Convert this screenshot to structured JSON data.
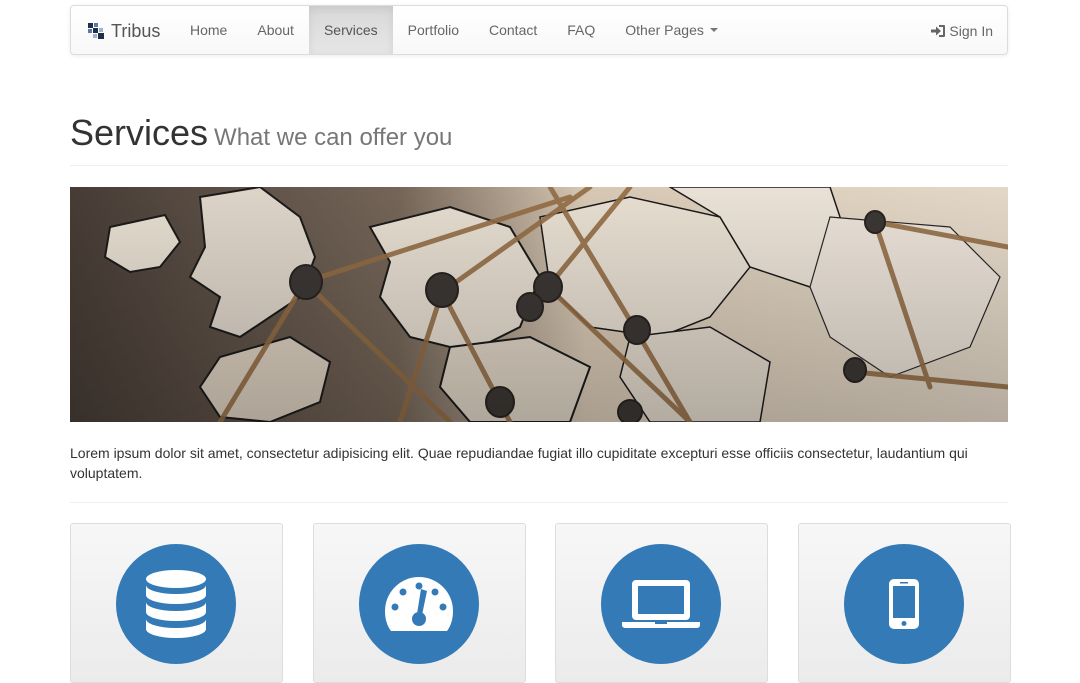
{
  "navbar": {
    "brand": "Tribus",
    "brand_icon": "tiles-logo-icon",
    "items": [
      {
        "label": "Home"
      },
      {
        "label": "About"
      },
      {
        "label": "Services",
        "active": true
      },
      {
        "label": "Portfolio"
      },
      {
        "label": "Contact"
      },
      {
        "label": "FAQ"
      },
      {
        "label": "Other Pages",
        "dropdown": true
      }
    ],
    "signin": {
      "label": "Sign In",
      "icon": "sign-in-icon"
    }
  },
  "header": {
    "title": "Services",
    "subtitle": "What we can offer you"
  },
  "hero": {
    "image": "europe-map-pins-and-string"
  },
  "intro": "Lorem ipsum dolor sit amet, consectetur adipisicing elit. Quae repudiandae fugiat illo cupiditate excepturi esse officiis consectetur, laudantium qui voluptatem.",
  "features": [
    {
      "icon": "database-icon"
    },
    {
      "icon": "dashboard-gauge-icon"
    },
    {
      "icon": "laptop-icon"
    },
    {
      "icon": "mobile-phone-icon"
    }
  ],
  "colors": {
    "accent": "#337ab7",
    "navbar_active": "#e0e0e0"
  }
}
